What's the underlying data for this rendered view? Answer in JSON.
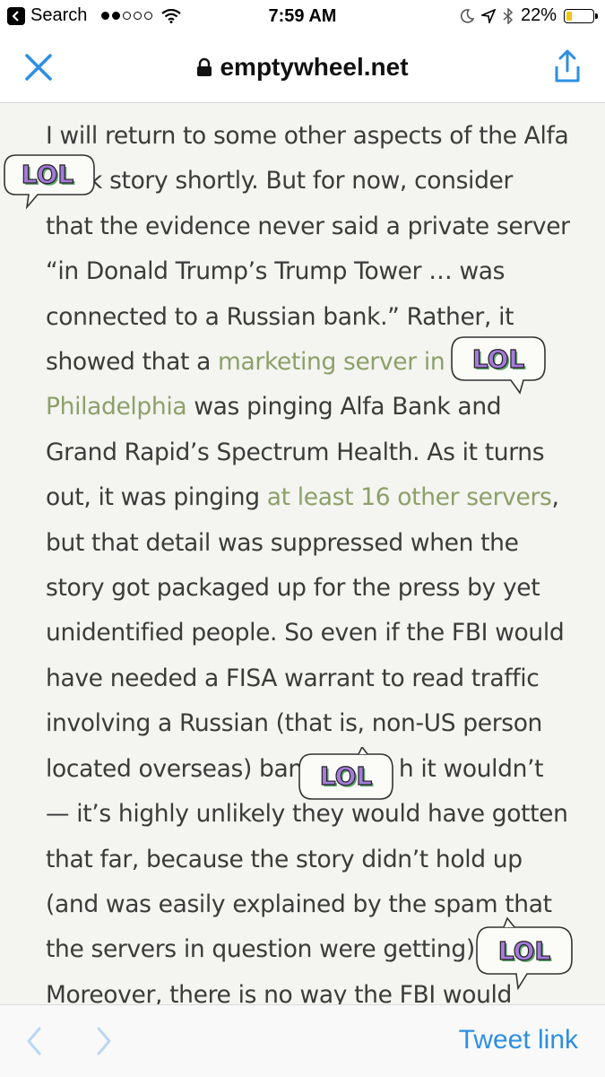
{
  "status_bar": {
    "back_label": "Search",
    "time": "7:59 AM",
    "battery_percent": "22%",
    "battery_level": 0.22,
    "signal_bars_filled": 2,
    "signal_bars_total": 5
  },
  "nav": {
    "title": "emptywheel.net",
    "close_icon": "close-icon",
    "lock_icon": "lock-icon",
    "share_icon": "share-icon"
  },
  "article": {
    "lines": [
      [
        "I will return to some other aspects of the Alfa"
      ],
      [
        "k story shortly. But for now, consider"
      ],
      [
        "that the evidence never said a private server"
      ],
      [
        "“in Donald Trump’s Trump Tower … was"
      ],
      [
        "connected to a Russian bank.” Rather, it"
      ],
      [
        "showed that a ",
        "marketing server in"
      ],
      [
        "Philadelphia",
        " was pinging Alfa Bank and"
      ],
      [
        "Grand Rapid’s Spectrum Health. As it turns"
      ],
      [
        "out, it was pinging ",
        "at least 16 other servers",
        ","
      ],
      [
        "but that detail was suppressed when the"
      ],
      [
        "story got packaged up for the press by yet"
      ],
      [
        "unidentified people. So even if the FBI would"
      ],
      [
        "have needed a FISA warrant to read traffic"
      ],
      [
        "involving a Russian (that is, non-US person"
      ],
      [
        "located overseas) banl",
        "h it wouldn’t"
      ],
      [
        "— it’s highly unlikely they would have gotten"
      ],
      [
        "that far, because the story didn’t hold up"
      ],
      [
        "(and was easily explained by the spam that"
      ],
      [
        "the servers in question were getting)."
      ],
      [
        "Moreover, there is no way the FBI would"
      ]
    ],
    "link_color": "#8ca06a",
    "text_color": "#3b3b3b"
  },
  "stickers": {
    "text": "LOL",
    "fill_color": "#a47bdb",
    "shadow_color": "#5fa36a"
  },
  "toolbar": {
    "back_icon": "chevron-left-icon",
    "forward_icon": "chevron-right-icon",
    "tweet_link_label": "Tweet link",
    "accent": "#2d8fe3"
  }
}
